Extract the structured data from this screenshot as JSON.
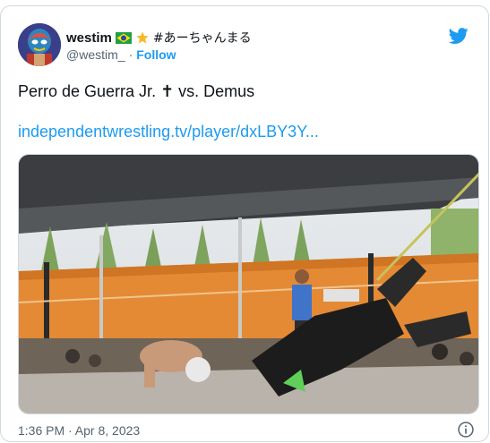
{
  "tweet": {
    "author": {
      "display_name": "westim",
      "name_suffix": "#あーちゃんまる",
      "handle": "@westim_",
      "separator": "·",
      "follow_label": "Follow",
      "flag_icon": "brazil-flag-icon",
      "star_icon": "star-icon"
    },
    "text": "Perro de Guerra Jr. ✝ vs. Demus",
    "link_text": "independentwrestling.tv/player/dxLBY3Y...",
    "timestamp": "1:36 PM · Apr 8, 2023",
    "icons": {
      "platform": "twitter-bird-icon",
      "info": "info-icon",
      "avatar": "avatar"
    },
    "colors": {
      "link": "#1d9bf0",
      "secondary_text": "#536471",
      "border": "#cfd9de"
    }
  }
}
